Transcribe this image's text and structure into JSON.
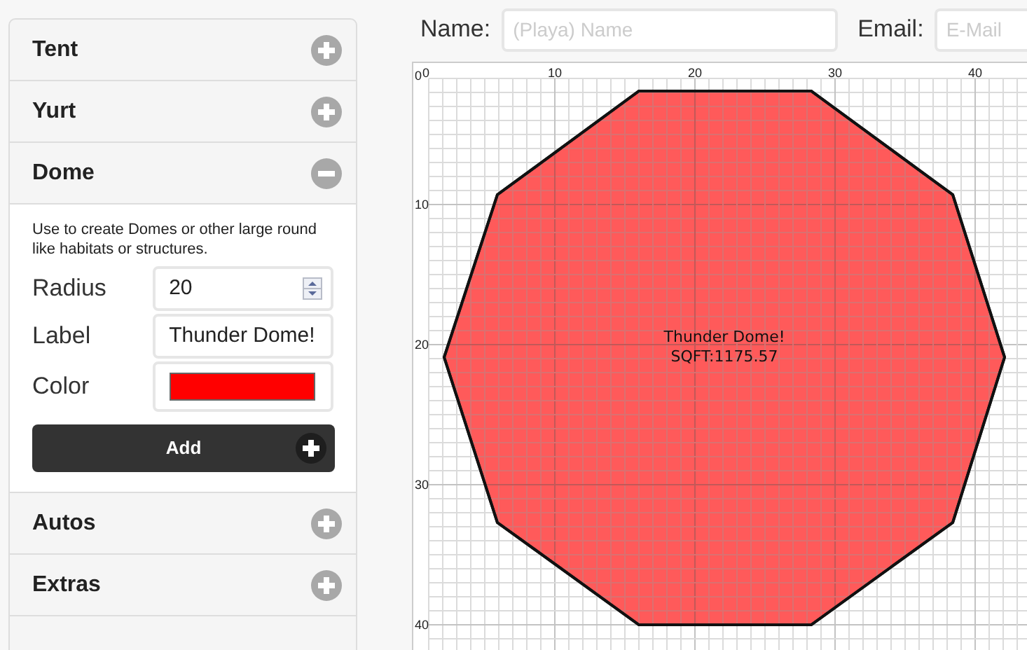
{
  "sections": [
    {
      "label": "Tent",
      "expanded": false
    },
    {
      "label": "Yurt",
      "expanded": false
    },
    {
      "label": "Dome",
      "expanded": true,
      "description": "Use to create Domes or other large round like habitats or structures.",
      "fields": [
        {
          "kind": "number",
          "label": "Radius",
          "value": "20"
        },
        {
          "kind": "text",
          "label": "Label",
          "value": "Thunder Dome!"
        },
        {
          "kind": "color",
          "label": "Color",
          "color": "#ff0000"
        }
      ],
      "button": "Add"
    },
    {
      "label": "Autos",
      "expanded": false
    },
    {
      "label": "Extras",
      "expanded": false
    }
  ],
  "header": {
    "name_label": "Name:",
    "name_placeholder": "(Playa) Name",
    "email_label": "Email:",
    "email_placeholder": "E-Mail"
  },
  "canvas": {
    "x_ticks": [
      "0",
      "10",
      "20",
      "30",
      "40"
    ],
    "y_ticks": [
      "0",
      "10",
      "20",
      "30",
      "40"
    ],
    "shape": {
      "label": "Thunder Dome!",
      "area": "SQFT:1175.57",
      "color": "#ff5a5a"
    }
  }
}
